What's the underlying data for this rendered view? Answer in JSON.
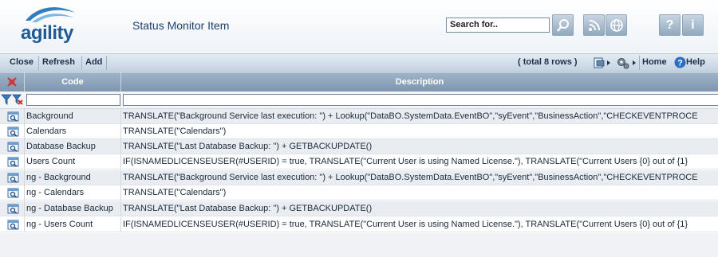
{
  "header": {
    "logo_text": "agility",
    "page_title": "Status Monitor Item",
    "search_placeholder": "Search for..",
    "help_glyph": "?",
    "info_glyph": "i"
  },
  "toolbar": {
    "close_label": "Close",
    "refresh_label": "Refresh",
    "add_label": "Add",
    "rows_text": "( total 8 rows )",
    "home_label": "Home",
    "help_label": "Help"
  },
  "grid": {
    "columns": {
      "code": "Code",
      "description": "Description"
    },
    "rows": [
      {
        "code": "Background",
        "description": "TRANSLATE(\"Background Service last execution: \") + Lookup(\"DataBO.SystemData.EventBO\",\"syEvent\",\"BusinessAction\",\"CHECKEVENTPROCE"
      },
      {
        "code": "Calendars",
        "description": "TRANSLATE(\"Calendars\")"
      },
      {
        "code": "Database Backup",
        "description": "TRANSLATE(\"Last Database Backup: \") + GETBACKUPDATE()"
      },
      {
        "code": "Users Count",
        "description": "IF(ISNAMEDLICENSEUSER(#USERID) = true, TRANSLATE(\"Current User is using Named License.\"), TRANSLATE(\"Current Users {0} out of {1}"
      },
      {
        "code": "ng - Background",
        "description": "TRANSLATE(\"Background Service last execution: \") + Lookup(\"DataBO.SystemData.EventBO\",\"syEvent\",\"BusinessAction\",\"CHECKEVENTPROCE"
      },
      {
        "code": "ng - Calendars",
        "description": "TRANSLATE(\"Calendars\")"
      },
      {
        "code": "ng - Database Backup",
        "description": "TRANSLATE(\"Last Database Backup: \") + GETBACKUPDATE()"
      },
      {
        "code": "ng - Users Count",
        "description": "IF(ISNAMEDLICENSEUSER(#USERID) = true, TRANSLATE(\"Current User is using Named License.\"), TRANSLATE(\"Current Users {0} out of {1}"
      }
    ]
  },
  "icons": {
    "search": "magnifier-icon",
    "rss": "rss-icon",
    "globe": "globe-icon",
    "help": "help-icon",
    "info": "info-icon",
    "export": "export-icon",
    "settings": "gear-icon",
    "home_help": "help-circle-icon",
    "clear_filter": "clear-filter-icon",
    "filter": "filter-icon",
    "row_view": "view-record-icon"
  },
  "colors": {
    "brand": "#1f5a96",
    "header_grid": "#8aa2ba",
    "row_alt": "#e9edf2"
  }
}
